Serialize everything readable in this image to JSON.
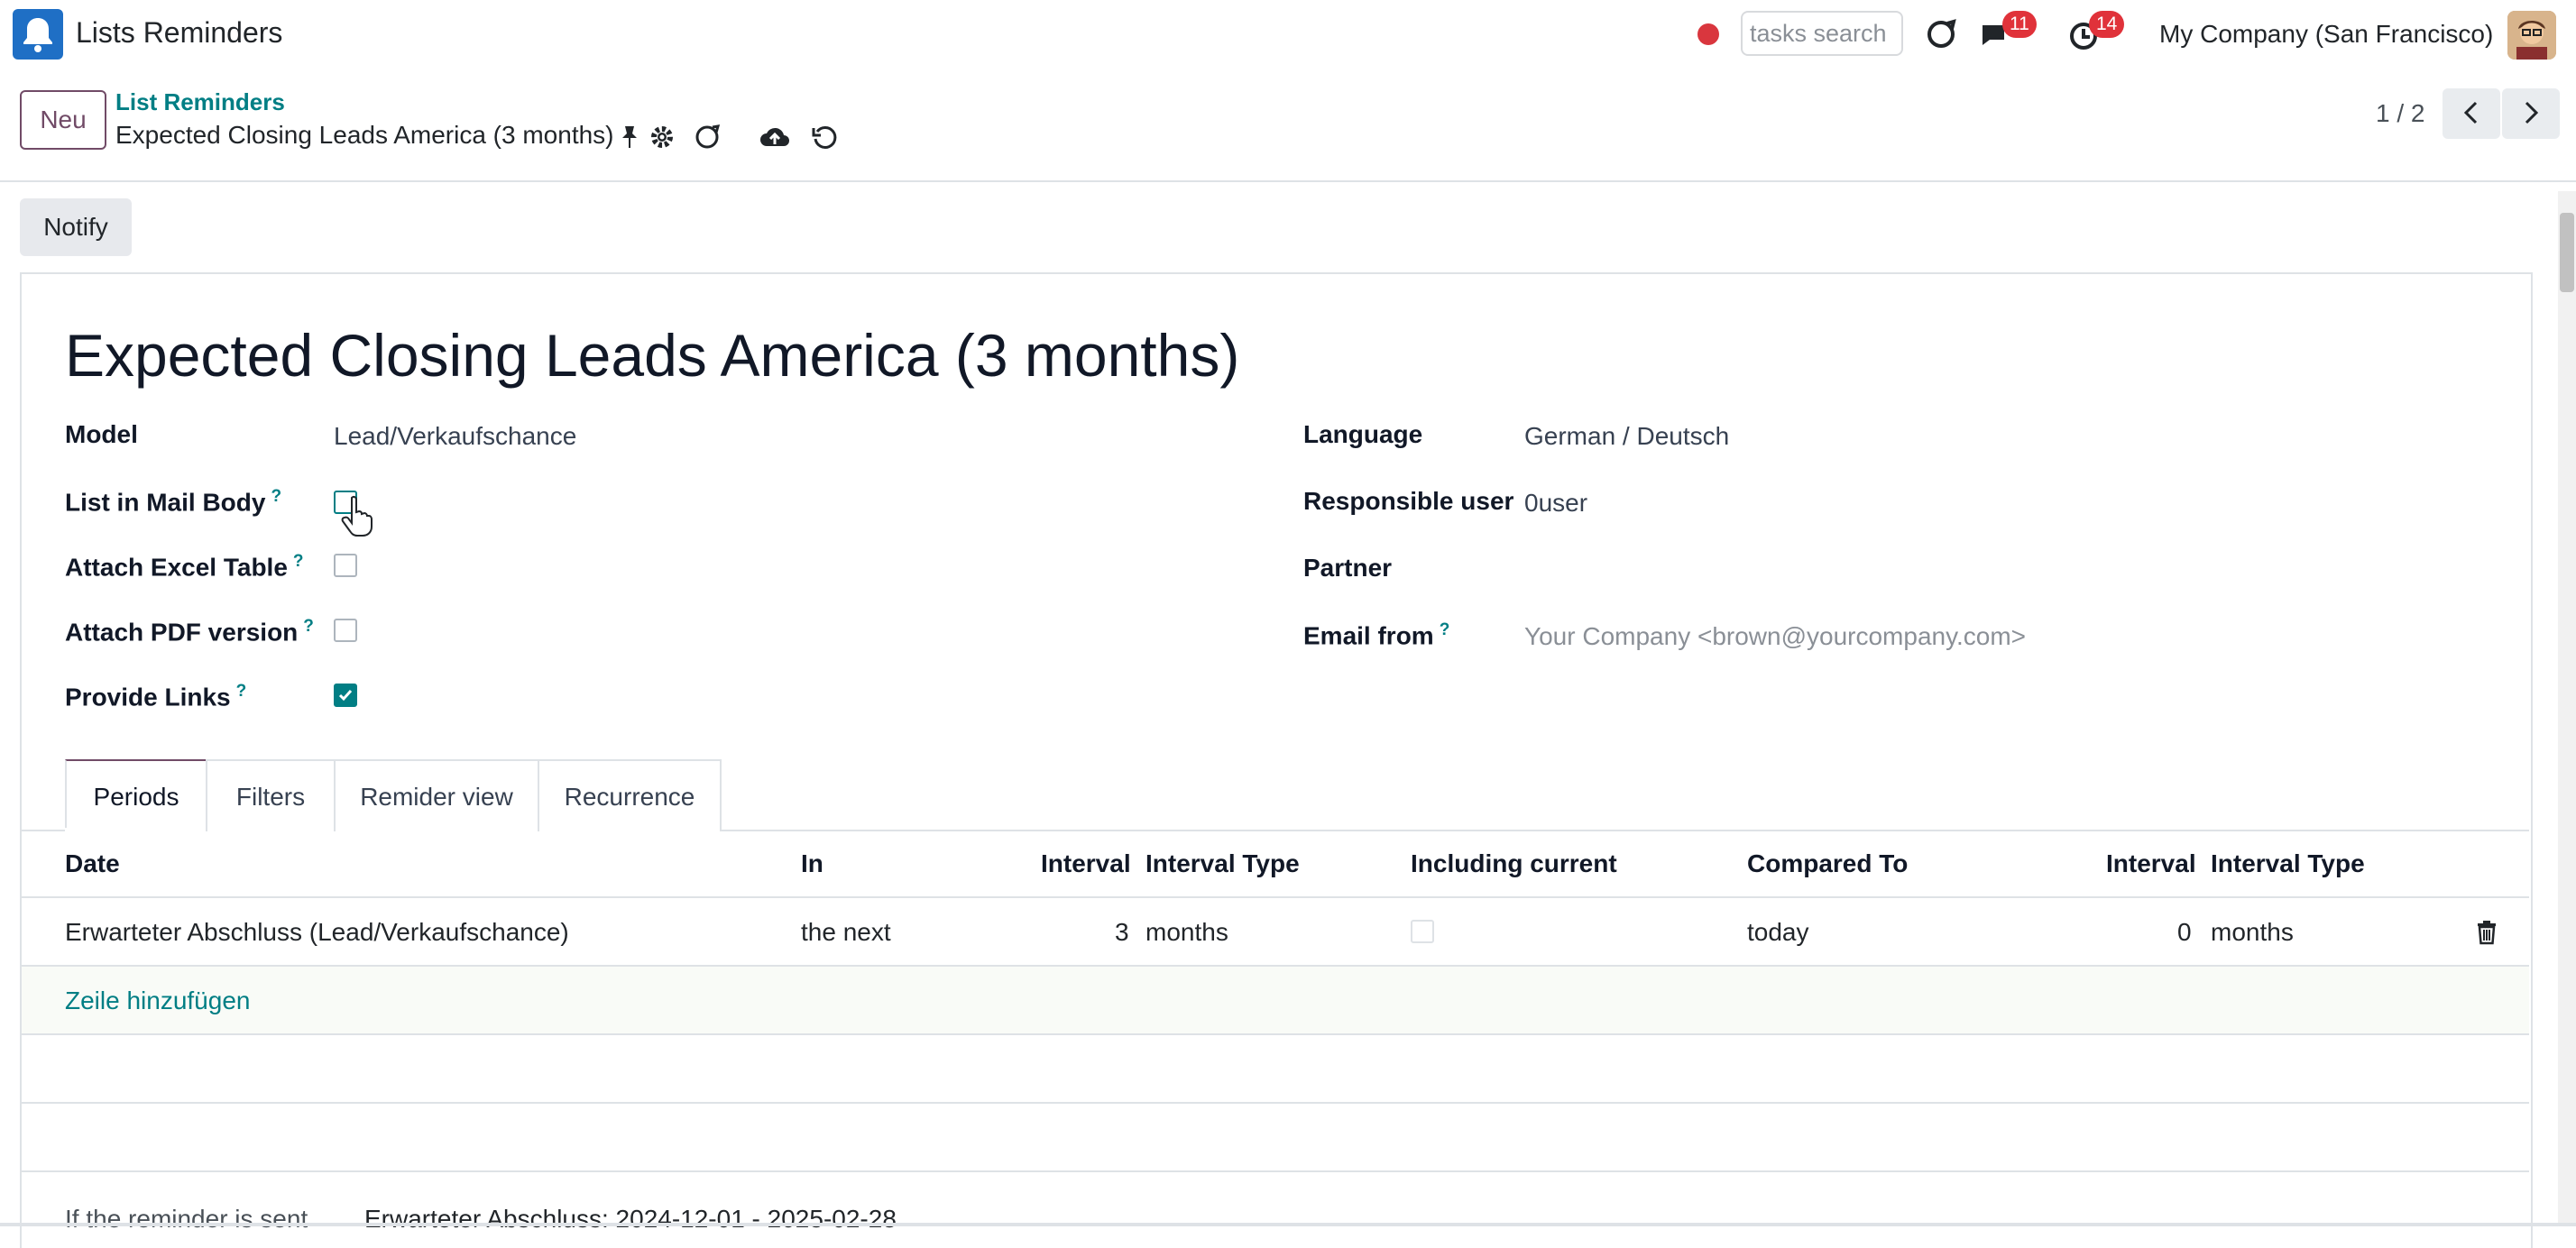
{
  "navbar": {
    "app_title": "Lists Reminders",
    "search_placeholder": "tasks search",
    "messages_count": "11",
    "activities_count": "14",
    "company": "My Company (San Francisco)",
    "record_dot_color": "#d9363e"
  },
  "control_panel": {
    "new_label": "Neu",
    "breadcrumb_parent": "List Reminders",
    "record_title": "Expected Closing Leads America (3 months)",
    "pager_value": "1 / 2"
  },
  "statusbar": {
    "notify_label": "Notify"
  },
  "form": {
    "title": "Expected Closing Leads America (3 months)",
    "left_fields": [
      {
        "label": "Model",
        "value": "Lead/Verkaufschance"
      },
      {
        "label": "List in Mail Body",
        "help": "?",
        "checked": false
      },
      {
        "label": "Attach Excel Table",
        "help": "?",
        "checked": false
      },
      {
        "label": "Attach PDF version",
        "help": "?",
        "checked": false
      },
      {
        "label": "Provide Links",
        "help": "?",
        "checked": true
      }
    ],
    "right_fields": [
      {
        "label": "Language",
        "value": "German / Deutsch"
      },
      {
        "label": "Responsible user",
        "value": "0user"
      },
      {
        "label": "Partner",
        "value": ""
      },
      {
        "label": "Email from",
        "help": "?",
        "placeholder": "Your Company <brown@yourcompany.com>"
      }
    ]
  },
  "tabs": [
    "Periods",
    "Filters",
    "Remider view",
    "Recurrence"
  ],
  "table": {
    "headers": [
      "Date",
      "In",
      "Interval",
      "Interval Type",
      "Including current",
      "Compared To",
      "Interval",
      "Interval Type"
    ],
    "rows": [
      {
        "date": "Erwarteter Abschluss (Lead/Verkaufschance)",
        "in": "the next",
        "interval": "3",
        "interval_type": "months",
        "including_current": false,
        "compared_to": "today",
        "interval2": "0",
        "interval_type2": "months"
      }
    ],
    "add_line": "Zeile hinzufügen"
  },
  "footer": {
    "label": "If the reminder is sent",
    "value": "Erwarteter Abschluss: 2024-12-01 - 2025-02-28"
  },
  "colors": {
    "accent": "#017e84",
    "brand": "#714b67",
    "badge": "#e0323a"
  }
}
